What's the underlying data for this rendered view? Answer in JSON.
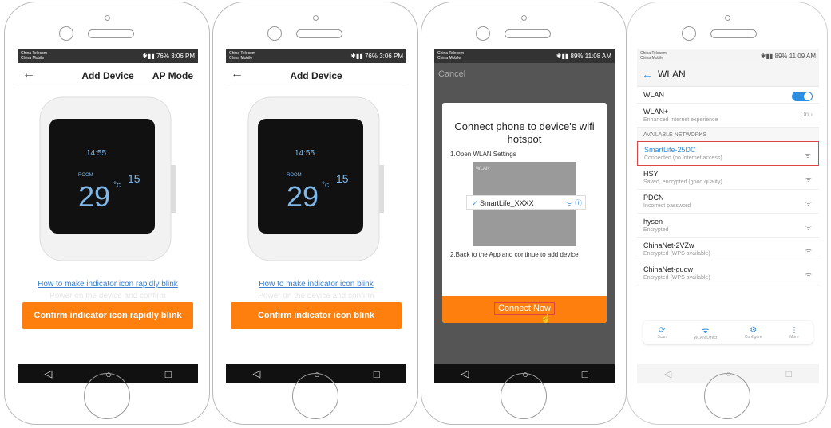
{
  "phone1": {
    "status": {
      "carriers": [
        "China Telecom",
        "China Mobile"
      ],
      "battery": "76%",
      "time": "3:06 PM"
    },
    "title": "Add Device",
    "ap_mode": "AP Mode",
    "thermostat": {
      "room_label": "ROOM",
      "current_temp": "29",
      "unit": "°c",
      "set_temp": "15",
      "time": "14:55"
    },
    "link": "How to make indicator icon rapidly blink",
    "ghost_text": "Power on the device and confirm",
    "button": "Confirm indicator icon rapidly blink"
  },
  "phone2": {
    "status": {
      "carriers": [
        "China Telecom",
        "China Mobile"
      ],
      "battery": "76%",
      "time": "3:06 PM"
    },
    "title": "Add Device",
    "thermostat": {
      "room_label": "ROOM",
      "current_temp": "29",
      "unit": "°c",
      "set_temp": "15",
      "time": "14:55"
    },
    "link": "How to make indicator icon blink",
    "ghost_text": "Power on the device and confirm",
    "button": "Confirm indicator icon blink"
  },
  "phone3": {
    "status": {
      "carriers": [
        "China Telecom",
        "China Mobile"
      ],
      "battery": "89%",
      "time": "11:08 AM"
    },
    "cancel": "Cancel",
    "dialog_title": "Connect phone to device's wifi hotspot",
    "step1": "1.Open WLAN Settings",
    "mock_wlan": "WLAN",
    "mock_network": "SmartLife_XXXX",
    "step2": "2.Back to the App and continue to add device",
    "button": "Connect Now"
  },
  "phone4": {
    "status": {
      "carriers": [
        "China Telecom",
        "China Mobile"
      ],
      "battery": "89%",
      "time": "11:09 AM"
    },
    "title": "WLAN",
    "wlan_label": "WLAN",
    "wlan_plus": {
      "label": "WLAN+",
      "sub": "Enhanced Internet experience",
      "state": "On"
    },
    "section": "AVAILABLE NETWORKS",
    "networks": [
      {
        "name": "SmartLife-25DC",
        "sub": "Connected (no Internet access)"
      },
      {
        "name": "HSY",
        "sub": "Saved, encrypted (good quality)"
      },
      {
        "name": "PDCN",
        "sub": "Incorrect password"
      },
      {
        "name": "hysen",
        "sub": "Encrypted"
      },
      {
        "name": "ChinaNet-2VZw",
        "sub": "Encrypted (WPS available)"
      },
      {
        "name": "ChinaNet-guqw",
        "sub": "Encrypted (WPS available)"
      }
    ],
    "tools": [
      "Scan",
      "WLAN Direct",
      "Configure",
      "More"
    ]
  },
  "colors": {
    "accent": "#ff7f0e",
    "link": "#3a7fd0",
    "wlan_blue": "#2b8ee0",
    "highlight": "#e04545"
  }
}
